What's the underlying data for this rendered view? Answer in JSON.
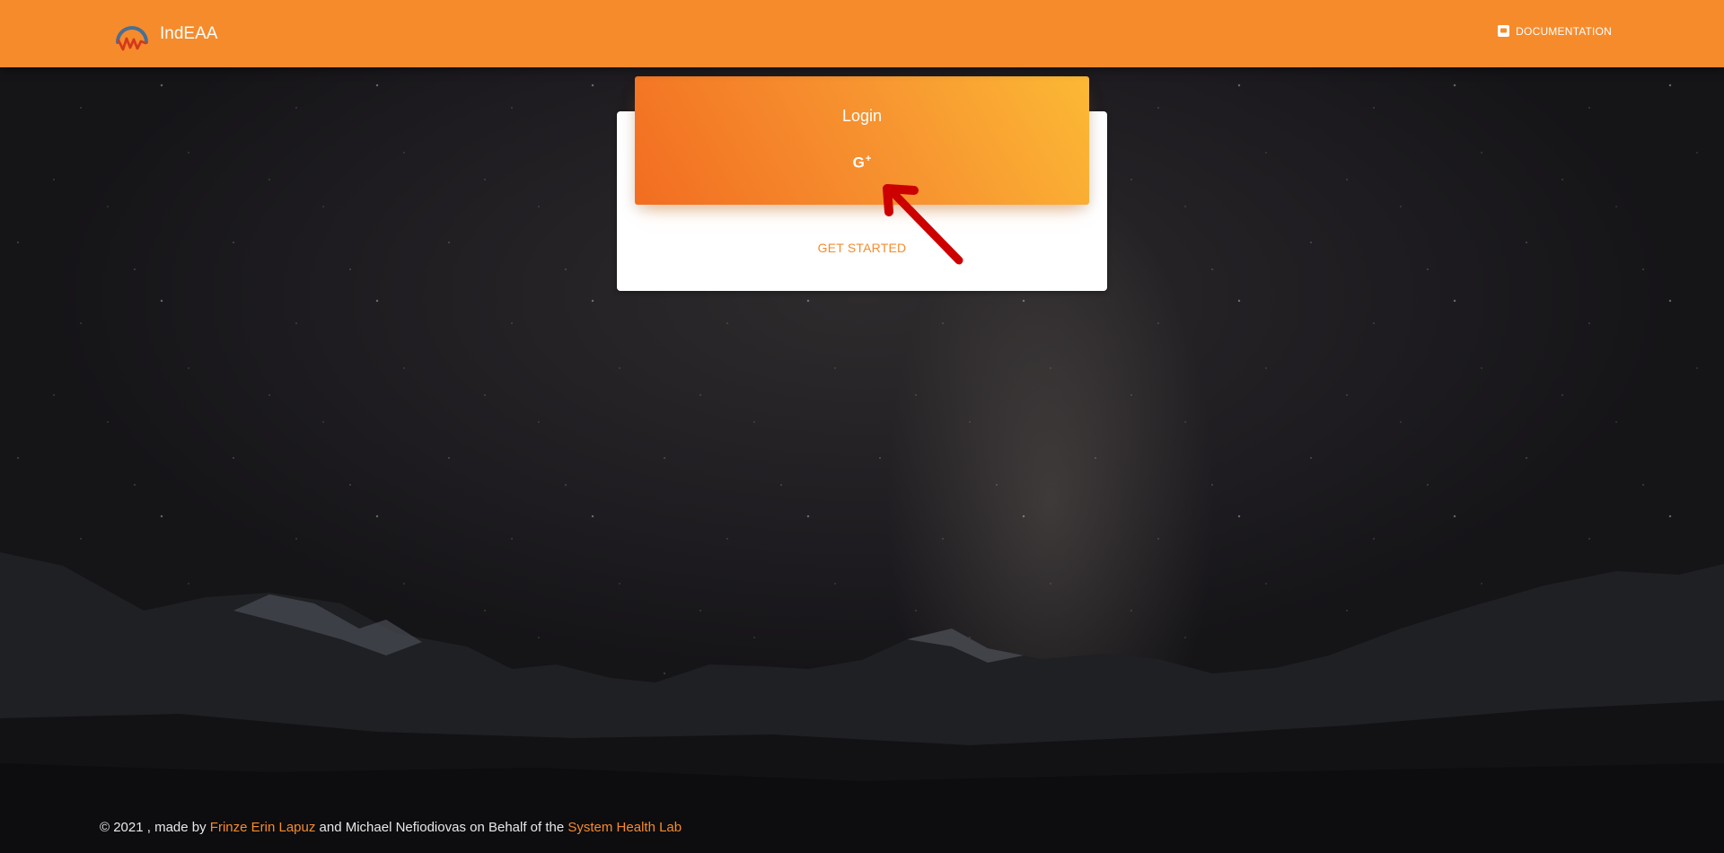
{
  "navbar": {
    "brand_name": "IndEAA",
    "logo_icon": "indeaa-logo-icon",
    "documentation_label": "DOCUMENTATION",
    "documentation_icon": "book-icon",
    "background_color": "#f68b2c"
  },
  "login_card": {
    "title": "Login",
    "google_icon": "google-plus-icon",
    "google_label": "G",
    "google_sup": "+",
    "get_started_label": "GET STARTED",
    "header_gradient": [
      "#f26d21",
      "#fcb935"
    ]
  },
  "annotation": {
    "arrow_color": "#cc0000"
  },
  "footer": {
    "prefix": "© 2021 , made by ",
    "author_link": "Frinze Erin Lapuz",
    "middle": " and Michael Nefiodiovas on Behalf of the ",
    "lab_link": "System Health Lab"
  }
}
